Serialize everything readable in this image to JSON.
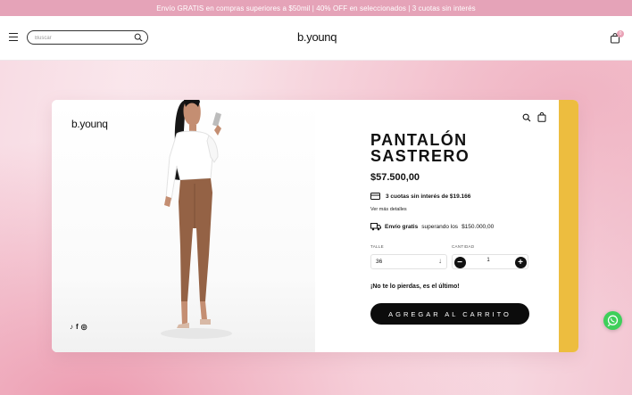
{
  "promo": {
    "text": "Envío GRATIS en compras superiores a $50mil | 40% OFF en seleccionados | 3 cuotas sin interés"
  },
  "header": {
    "logo": "b.younq",
    "search_placeholder": "Buscar",
    "cart_count": "0"
  },
  "product": {
    "brand_logo": "b.younq",
    "title": "PANTALÓN SASTRERO",
    "price": "$57.500,00",
    "installments_text": "3 cuotas sin interés de $19.166",
    "details_link": "Ver más detalles",
    "shipping_bold": "Envío gratis",
    "shipping_text": "superando los",
    "shipping_amount": "$150.000,00",
    "size_label": "TALLE",
    "size_value": "36",
    "qty_label": "CANTIDAD",
    "qty_value": "1",
    "urgency": "¡No te lo pierdas, es el último!",
    "add_to_cart": "AGREGAR AL CARRITO"
  },
  "socials": [
    "tiktok-icon",
    "facebook-icon",
    "instagram-icon"
  ],
  "colors": {
    "promo_bg": "#e5a3b8",
    "accent": "#edbd3f",
    "button": "#0c0c0c",
    "whatsapp": "#3ecf5a"
  }
}
